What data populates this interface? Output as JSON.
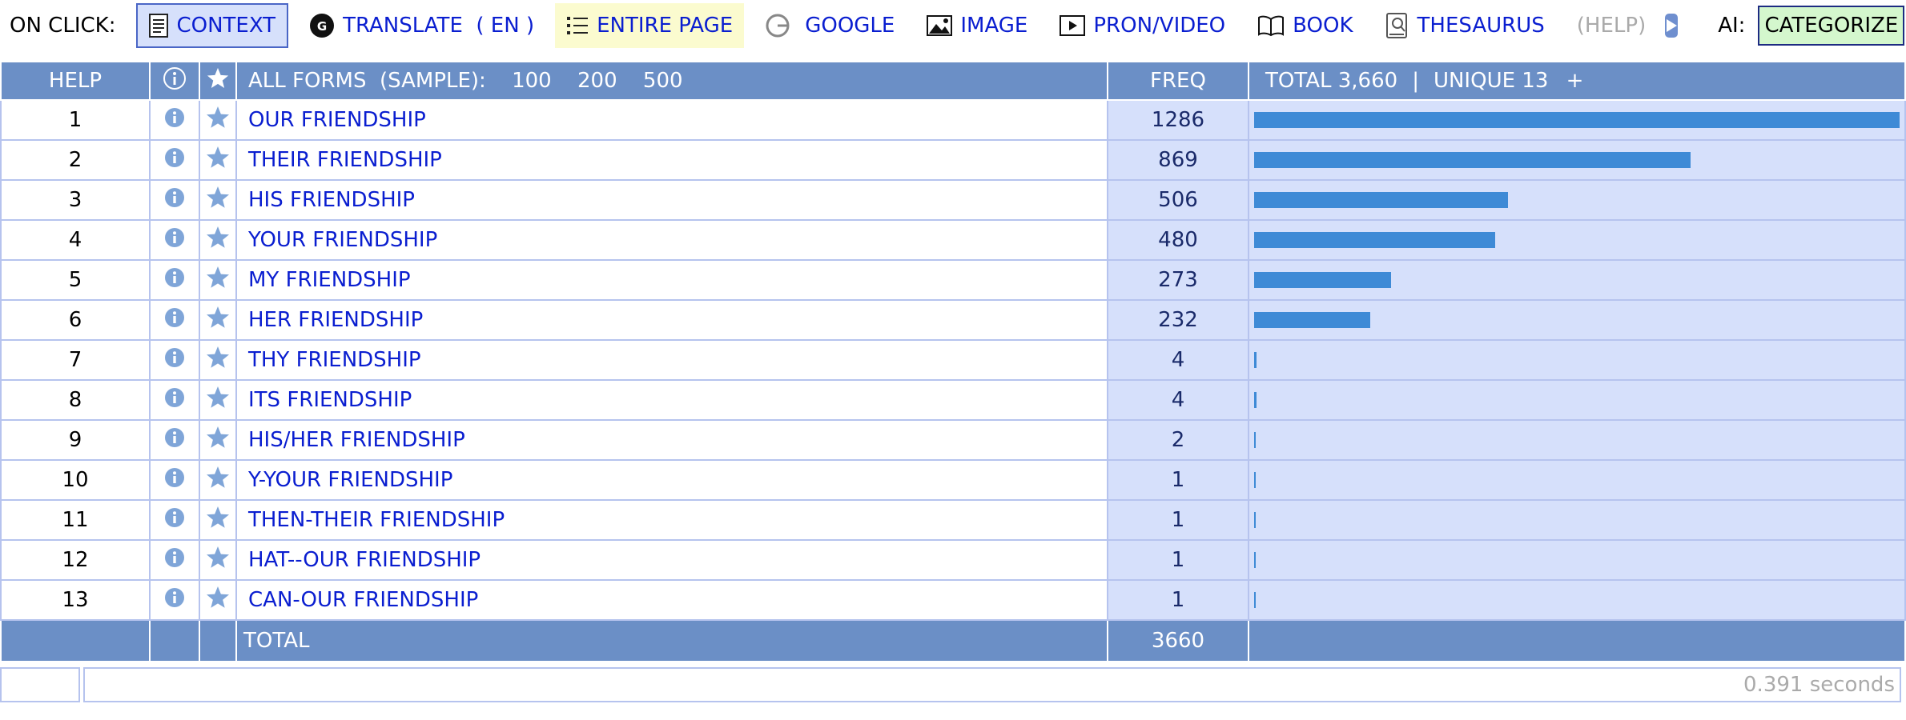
{
  "toolbar": {
    "on_click_label": "ON CLICK:",
    "items": [
      {
        "key": "context",
        "label": "CONTEXT",
        "icon": "document-icon"
      },
      {
        "key": "translate",
        "label": "TRANSLATE  ( EN )",
        "icon": "translate-icon"
      },
      {
        "key": "entire_page",
        "label": "ENTIRE PAGE",
        "icon": "list-icon"
      },
      {
        "key": "google",
        "label": "GOOGLE",
        "icon": "google-icon"
      },
      {
        "key": "image",
        "label": "IMAGE",
        "icon": "image-icon"
      },
      {
        "key": "pron_video",
        "label": "PRON/VIDEO",
        "icon": "play-icon"
      },
      {
        "key": "book",
        "label": "BOOK",
        "icon": "book-icon"
      },
      {
        "key": "thesaurus",
        "label": "THESAURUS",
        "icon": "thesaurus-icon"
      }
    ],
    "help_label": "(HELP)",
    "ai_label": "AI:",
    "categorize_label": "CATEGORIZE",
    "star_label": "*"
  },
  "table": {
    "header": {
      "help": "HELP",
      "all_forms": "ALL FORMS  (SAMPLE):",
      "samples": [
        "100",
        "200",
        "500"
      ],
      "freq": "FREQ",
      "total": "TOTAL 3,660",
      "separator": "|",
      "unique": "UNIQUE 13",
      "plus": "+"
    },
    "rows": [
      {
        "n": "1",
        "word": "OUR FRIENDSHIP",
        "freq": 1286
      },
      {
        "n": "2",
        "word": "THEIR FRIENDSHIP",
        "freq": 869
      },
      {
        "n": "3",
        "word": "HIS FRIENDSHIP",
        "freq": 506
      },
      {
        "n": "4",
        "word": "YOUR FRIENDSHIP",
        "freq": 480
      },
      {
        "n": "5",
        "word": "MY FRIENDSHIP",
        "freq": 273
      },
      {
        "n": "6",
        "word": "HER FRIENDSHIP",
        "freq": 232
      },
      {
        "n": "7",
        "word": "THY FRIENDSHIP",
        "freq": 4
      },
      {
        "n": "8",
        "word": "ITS FRIENDSHIP",
        "freq": 4
      },
      {
        "n": "9",
        "word": "HIS/HER FRIENDSHIP",
        "freq": 2
      },
      {
        "n": "10",
        "word": "Y-YOUR FRIENDSHIP",
        "freq": 1
      },
      {
        "n": "11",
        "word": "THEN-THEIR FRIENDSHIP",
        "freq": 1
      },
      {
        "n": "12",
        "word": "HAT--OUR FRIENDSHIP",
        "freq": 1
      },
      {
        "n": "13",
        "word": "CAN-OUR FRIENDSHIP",
        "freq": 1
      }
    ],
    "footer": {
      "label": "TOTAL",
      "freq": "3660"
    }
  },
  "status": {
    "timing": "0.391 seconds"
  },
  "colors": {
    "header_bg": "#6b8fc6",
    "freq_bg": "#d6e0fb",
    "bar": "#3e8ad6",
    "link": "#0a1ed0",
    "icon": "#7fa5d8"
  }
}
